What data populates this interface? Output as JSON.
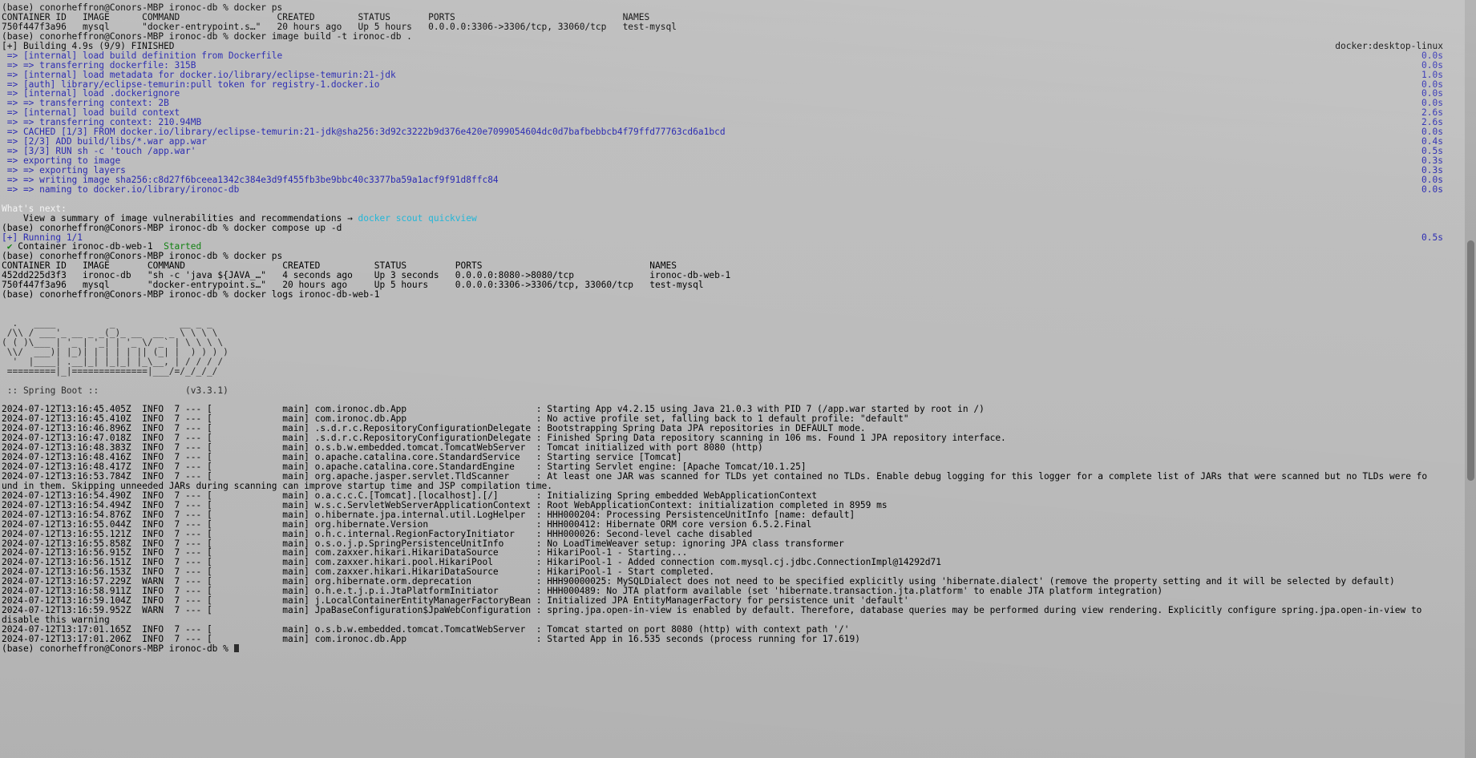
{
  "terminal": {
    "prompt": "(base) conorheffron@Conors-MBP ironoc-db % ",
    "colors": {
      "background": "#bcbcbc",
      "foreground": "#000000",
      "blue": "#2727b0",
      "cyan": "#1fb6d8",
      "green": "#108010",
      "white": "#f4f4f4"
    },
    "commands": {
      "docker_ps": "docker ps",
      "docker_build": "docker image build -t ironoc-db .",
      "docker_compose_up": "docker compose up -d",
      "docker_logs": "docker logs ironoc-db-web-1"
    },
    "lines": [
      {
        "id": "l001",
        "type": "prompt",
        "cmd": "docker ps"
      },
      {
        "id": "l002",
        "type": "plain",
        "text": "CONTAINER ID   IMAGE      COMMAND                  CREATED        STATUS       PORTS                               NAMES"
      },
      {
        "id": "l003",
        "type": "plain",
        "text": "750f447f3a96   mysql      \"docker-entrypoint.s…\"   20 hours ago   Up 5 hours   0.0.0.0:3306->3306/tcp, 33060/tcp   test-mysql"
      },
      {
        "id": "l004",
        "type": "prompt",
        "cmd": "docker image build -t ironoc-db ."
      },
      {
        "id": "l005",
        "type": "build-head",
        "text": "[+] Building 4.9s (9/9) FINISHED",
        "right": "docker:desktop-linux"
      },
      {
        "id": "l006",
        "type": "build",
        "text": " => [internal] load build definition from Dockerfile",
        "right": "0.0s"
      },
      {
        "id": "l007",
        "type": "build",
        "text": " => => transferring dockerfile: 315B",
        "right": "0.0s"
      },
      {
        "id": "l008",
        "type": "build",
        "text": " => [internal] load metadata for docker.io/library/eclipse-temurin:21-jdk",
        "right": "1.0s"
      },
      {
        "id": "l009",
        "type": "build",
        "text": " => [auth] library/eclipse-temurin:pull token for registry-1.docker.io",
        "right": "0.0s"
      },
      {
        "id": "l010",
        "type": "build",
        "text": " => [internal] load .dockerignore",
        "right": "0.0s"
      },
      {
        "id": "l011",
        "type": "build",
        "text": " => => transferring context: 2B",
        "right": "0.0s"
      },
      {
        "id": "l012",
        "type": "build",
        "text": " => [internal] load build context",
        "right": "2.6s"
      },
      {
        "id": "l013",
        "type": "build",
        "text": " => => transferring context: 210.94MB",
        "right": "2.6s"
      },
      {
        "id": "l014",
        "type": "build",
        "text": " => CACHED [1/3] FROM docker.io/library/eclipse-temurin:21-jdk@sha256:3d92c3222b9d376e420e7099054604dc0d7bafbebbcb4f79ffd77763cd6a1bcd",
        "right": "0.0s"
      },
      {
        "id": "l015",
        "type": "build",
        "text": " => [2/3] ADD build/libs/*.war app.war",
        "right": "0.4s"
      },
      {
        "id": "l016",
        "type": "build",
        "text": " => [3/3] RUN sh -c 'touch /app.war'",
        "right": "0.5s"
      },
      {
        "id": "l017",
        "type": "build",
        "text": " => exporting to image",
        "right": "0.3s"
      },
      {
        "id": "l018",
        "type": "build",
        "text": " => => exporting layers",
        "right": "0.3s"
      },
      {
        "id": "l019",
        "type": "build",
        "text": " => => writing image sha256:c8d27f6bceea1342c384e3d9f455fb3be9bbc40c3377ba59a1acf9f91d8ffc84",
        "right": "0.0s"
      },
      {
        "id": "l020",
        "type": "build",
        "text": " => => naming to docker.io/library/ironoc-db",
        "right": "0.0s"
      },
      {
        "id": "l021",
        "type": "blank",
        "text": ""
      },
      {
        "id": "l022",
        "type": "whats-next",
        "text": "What's next:"
      },
      {
        "id": "l023",
        "type": "scout",
        "pre": "    View a summary of image vulnerabilities and recommendations → ",
        "link": "docker scout quickview"
      },
      {
        "id": "l024",
        "type": "prompt",
        "cmd": "docker compose up -d"
      },
      {
        "id": "l025",
        "type": "running-head",
        "text": "[+] Running 1/1",
        "right": "0.5s"
      },
      {
        "id": "l026",
        "type": "container-started",
        "check": " ✔ ",
        "text": "Container ironoc-db-web-1",
        "status": "Started"
      },
      {
        "id": "l027",
        "type": "prompt",
        "cmd": "docker ps"
      },
      {
        "id": "l028",
        "type": "plain",
        "text": "CONTAINER ID   IMAGE       COMMAND                  CREATED          STATUS         PORTS                               NAMES"
      },
      {
        "id": "l029",
        "type": "plain",
        "text": "452dd225d3f3   ironoc-db   \"sh -c 'java ${JAVA_…\"   4 seconds ago    Up 3 seconds   0.0.0.0:8080->8080/tcp              ironoc-db-web-1"
      },
      {
        "id": "l030",
        "type": "plain",
        "text": "750f447f3a96   mysql       \"docker-entrypoint.s…\"   20 hours ago     Up 5 hours     0.0.0.0:3306->3306/tcp, 33060/tcp   test-mysql"
      },
      {
        "id": "l031",
        "type": "prompt",
        "cmd": "docker logs ironoc-db-web-1"
      },
      {
        "id": "l032",
        "type": "blank",
        "text": ""
      },
      {
        "id": "l033",
        "type": "banner",
        "text": ""
      },
      {
        "id": "l034",
        "type": "banner",
        "text": "  .   ____          _            __ _ _"
      },
      {
        "id": "l035",
        "type": "banner",
        "text": " /\\\\ / ___'_ __ _ _(_)_ __  __ _ \\ \\ \\ \\"
      },
      {
        "id": "l036",
        "type": "banner",
        "text": "( ( )\\___ | '_ | '_| | '_ \\/ _` | \\ \\ \\ \\"
      },
      {
        "id": "l037",
        "type": "banner",
        "text": " \\\\/  ___)| |_)| | | | | || (_| |  ) ) ) )"
      },
      {
        "id": "l038",
        "type": "banner",
        "text": "  '  |____| .__|_| |_|_| |_\\__, | / / / /"
      },
      {
        "id": "l039",
        "type": "banner",
        "text": " =========|_|==============|___/=/_/_/_/"
      },
      {
        "id": "l040",
        "type": "blank",
        "text": ""
      },
      {
        "id": "l041",
        "type": "banner",
        "text": " :: Spring Boot ::                (v3.3.1)"
      },
      {
        "id": "l042",
        "type": "blank",
        "text": ""
      },
      {
        "id": "l043",
        "type": "log",
        "ts": "2024-07-12T13:16:45.405Z",
        "level": "INFO",
        "pid": "7",
        "thread": "main",
        "logger": "com.ironoc.db.App",
        "msg": "Starting App v4.2.15 using Java 21.0.3 with PID 7 (/app.war started by root in /)"
      },
      {
        "id": "l044",
        "type": "log",
        "ts": "2024-07-12T13:16:45.410Z",
        "level": "INFO",
        "pid": "7",
        "thread": "main",
        "logger": "com.ironoc.db.App",
        "msg": "No active profile set, falling back to 1 default profile: \"default\""
      },
      {
        "id": "l045",
        "type": "log",
        "ts": "2024-07-12T13:16:46.896Z",
        "level": "INFO",
        "pid": "7",
        "thread": "main",
        "logger": ".s.d.r.c.RepositoryConfigurationDelegate",
        "msg": "Bootstrapping Spring Data JPA repositories in DEFAULT mode."
      },
      {
        "id": "l046",
        "type": "log",
        "ts": "2024-07-12T13:16:47.018Z",
        "level": "INFO",
        "pid": "7",
        "thread": "main",
        "logger": ".s.d.r.c.RepositoryConfigurationDelegate",
        "msg": "Finished Spring Data repository scanning in 106 ms. Found 1 JPA repository interface."
      },
      {
        "id": "l047",
        "type": "log",
        "ts": "2024-07-12T13:16:48.383Z",
        "level": "INFO",
        "pid": "7",
        "thread": "main",
        "logger": "o.s.b.w.embedded.tomcat.TomcatWebServer",
        "msg": "Tomcat initialized with port 8080 (http)"
      },
      {
        "id": "l048",
        "type": "log",
        "ts": "2024-07-12T13:16:48.416Z",
        "level": "INFO",
        "pid": "7",
        "thread": "main",
        "logger": "o.apache.catalina.core.StandardService",
        "msg": "Starting service [Tomcat]"
      },
      {
        "id": "l049",
        "type": "log",
        "ts": "2024-07-12T13:16:48.417Z",
        "level": "INFO",
        "pid": "7",
        "thread": "main",
        "logger": "o.apache.catalina.core.StandardEngine",
        "msg": "Starting Servlet engine: [Apache Tomcat/10.1.25]"
      },
      {
        "id": "l050",
        "type": "log",
        "ts": "2024-07-12T13:16:53.784Z",
        "level": "INFO",
        "pid": "7",
        "thread": "main",
        "logger": "org.apache.jasper.servlet.TldScanner",
        "msg": "At least one JAR was scanned for TLDs yet contained no TLDs. Enable debug logging for this logger for a complete list of JARs that were scanned but no TLDs were fo"
      },
      {
        "id": "l051",
        "type": "cont",
        "text": "und in them. Skipping unneeded JARs during scanning can improve startup time and JSP compilation time."
      },
      {
        "id": "l052",
        "type": "log",
        "ts": "2024-07-12T13:16:54.490Z",
        "level": "INFO",
        "pid": "7",
        "thread": "main",
        "logger": "o.a.c.c.C.[Tomcat].[localhost].[/]",
        "msg": "Initializing Spring embedded WebApplicationContext"
      },
      {
        "id": "l053",
        "type": "log",
        "ts": "2024-07-12T13:16:54.494Z",
        "level": "INFO",
        "pid": "7",
        "thread": "main",
        "logger": "w.s.c.ServletWebServerApplicationContext",
        "msg": "Root WebApplicationContext: initialization completed in 8959 ms"
      },
      {
        "id": "l054",
        "type": "log",
        "ts": "2024-07-12T13:16:54.876Z",
        "level": "INFO",
        "pid": "7",
        "thread": "main",
        "logger": "o.hibernate.jpa.internal.util.LogHelper",
        "msg": "HHH000204: Processing PersistenceUnitInfo [name: default]"
      },
      {
        "id": "l055",
        "type": "log",
        "ts": "2024-07-12T13:16:55.044Z",
        "level": "INFO",
        "pid": "7",
        "thread": "main",
        "logger": "org.hibernate.Version",
        "msg": "HHH000412: Hibernate ORM core version 6.5.2.Final"
      },
      {
        "id": "l056",
        "type": "log",
        "ts": "2024-07-12T13:16:55.121Z",
        "level": "INFO",
        "pid": "7",
        "thread": "main",
        "logger": "o.h.c.internal.RegionFactoryInitiator",
        "msg": "HHH000026: Second-level cache disabled"
      },
      {
        "id": "l057",
        "type": "log",
        "ts": "2024-07-12T13:16:55.858Z",
        "level": "INFO",
        "pid": "7",
        "thread": "main",
        "logger": "o.s.o.j.p.SpringPersistenceUnitInfo",
        "msg": "No LoadTimeWeaver setup: ignoring JPA class transformer"
      },
      {
        "id": "l058",
        "type": "log",
        "ts": "2024-07-12T13:16:56.915Z",
        "level": "INFO",
        "pid": "7",
        "thread": "main",
        "logger": "com.zaxxer.hikari.HikariDataSource",
        "msg": "HikariPool-1 - Starting..."
      },
      {
        "id": "l059",
        "type": "log",
        "ts": "2024-07-12T13:16:56.151Z",
        "level": "INFO",
        "pid": "7",
        "thread": "main",
        "logger": "com.zaxxer.hikari.pool.HikariPool",
        "msg": "HikariPool-1 - Added connection com.mysql.cj.jdbc.ConnectionImpl@14292d71"
      },
      {
        "id": "l060",
        "type": "log",
        "ts": "2024-07-12T13:16:56.153Z",
        "level": "INFO",
        "pid": "7",
        "thread": "main",
        "logger": "com.zaxxer.hikari.HikariDataSource",
        "msg": "HikariPool-1 - Start completed."
      },
      {
        "id": "l061",
        "type": "log",
        "ts": "2024-07-12T13:16:57.229Z",
        "level": "WARN",
        "pid": "7",
        "thread": "main",
        "logger": "org.hibernate.orm.deprecation",
        "msg": "HHH90000025: MySQLDialect does not need to be specified explicitly using 'hibernate.dialect' (remove the property setting and it will be selected by default)"
      },
      {
        "id": "l062",
        "type": "log",
        "ts": "2024-07-12T13:16:58.911Z",
        "level": "INFO",
        "pid": "7",
        "thread": "main",
        "logger": "o.h.e.t.j.p.i.JtaPlatformInitiator",
        "msg": "HHH000489: No JTA platform available (set 'hibernate.transaction.jta.platform' to enable JTA platform integration)"
      },
      {
        "id": "l063",
        "type": "log",
        "ts": "2024-07-12T13:16:59.104Z",
        "level": "INFO",
        "pid": "7",
        "thread": "main",
        "logger": "j.LocalContainerEntityManagerFactoryBean",
        "msg": "Initialized JPA EntityManagerFactory for persistence unit 'default'"
      },
      {
        "id": "l064",
        "type": "log",
        "ts": "2024-07-12T13:16:59.952Z",
        "level": "WARN",
        "pid": "7",
        "thread": "main",
        "logger": "JpaBaseConfiguration$JpaWebConfiguration",
        "msg": "spring.jpa.open-in-view is enabled by default. Therefore, database queries may be performed during view rendering. Explicitly configure spring.jpa.open-in-view to"
      },
      {
        "id": "l065",
        "type": "cont",
        "text": "disable this warning"
      },
      {
        "id": "l066",
        "type": "log",
        "ts": "2024-07-12T13:17:01.165Z",
        "level": "INFO",
        "pid": "7",
        "thread": "main",
        "logger": "o.s.b.w.embedded.tomcat.TomcatWebServer",
        "msg": "Tomcat started on port 8080 (http) with context path '/'"
      },
      {
        "id": "l067",
        "type": "log",
        "ts": "2024-07-12T13:17:01.206Z",
        "level": "INFO",
        "pid": "7",
        "thread": "main",
        "logger": "com.ironoc.db.App",
        "msg": "Started App in 16.535 seconds (process running for 17.619)"
      },
      {
        "id": "l068",
        "type": "prompt-cursor",
        "cmd": ""
      }
    ]
  }
}
